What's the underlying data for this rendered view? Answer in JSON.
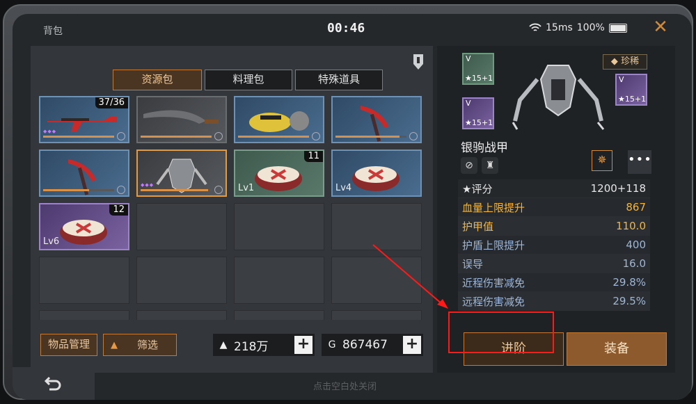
{
  "window": {
    "title": "背包",
    "clock": "00:46",
    "ping": "15ms",
    "battery": "100%",
    "battery_level": 1.0,
    "close_icon": "close-icon"
  },
  "tabs": [
    {
      "label": "资源包",
      "active": true
    },
    {
      "label": "料理包",
      "active": false
    },
    {
      "label": "特殊道具",
      "active": false
    }
  ],
  "grid": [
    {
      "kind": "blue",
      "icon": "rifle-icon",
      "count": "37/36",
      "gems": "◆◆◆",
      "progress": 1.0,
      "locked": true
    },
    {
      "kind": "gray",
      "icon": "machete-icon",
      "progress": 1.0,
      "locked": true
    },
    {
      "kind": "blue",
      "icon": "chainsaw-icon",
      "progress": 1.0,
      "locked": true
    },
    {
      "kind": "blue",
      "icon": "pickaxe-icon",
      "progress": 0.9,
      "locked": true
    },
    {
      "kind": "blue",
      "icon": "pickaxe-icon",
      "progress": 0.65,
      "locked": true
    },
    {
      "kind": "selected",
      "icon": "armor-icon",
      "gems": "◆◆◆",
      "progress": 0.95,
      "locked": true
    },
    {
      "kind": "green",
      "icon": "chest-icon",
      "count": "11",
      "level": "Lv1"
    },
    {
      "kind": "blue",
      "icon": "chest-icon",
      "level": "Lv4"
    },
    {
      "kind": "purple",
      "icon": "chest-icon",
      "count": "12",
      "level": "Lv6"
    }
  ],
  "buttons": {
    "manage": "物品管理",
    "filter": "筛选"
  },
  "resources": {
    "silver": "218万",
    "coins": "867467"
  },
  "hint": "点击空白处关闭",
  "detail": {
    "rarity": "珍稀",
    "name": "银驹战甲",
    "chips": [
      {
        "tier": "V",
        "stars": "★15+1"
      },
      {
        "tier": "V",
        "stars": "★15+1"
      },
      {
        "tier": "V",
        "stars": "★15+1"
      }
    ],
    "stats": [
      {
        "key": "评分",
        "value": "1200+118"
      },
      {
        "key": "血量上限提升",
        "value": "867"
      },
      {
        "key": "护甲值",
        "value": "110.0"
      },
      {
        "key": "护盾上限提升",
        "value": "400"
      },
      {
        "key": "误导",
        "value": "16.0"
      },
      {
        "key": "近程伤害减免",
        "value": "29.8%"
      },
      {
        "key": "远程伤害减免",
        "value": "29.5%"
      }
    ],
    "advance": "进阶",
    "equip": "装备",
    "more": "•••"
  }
}
